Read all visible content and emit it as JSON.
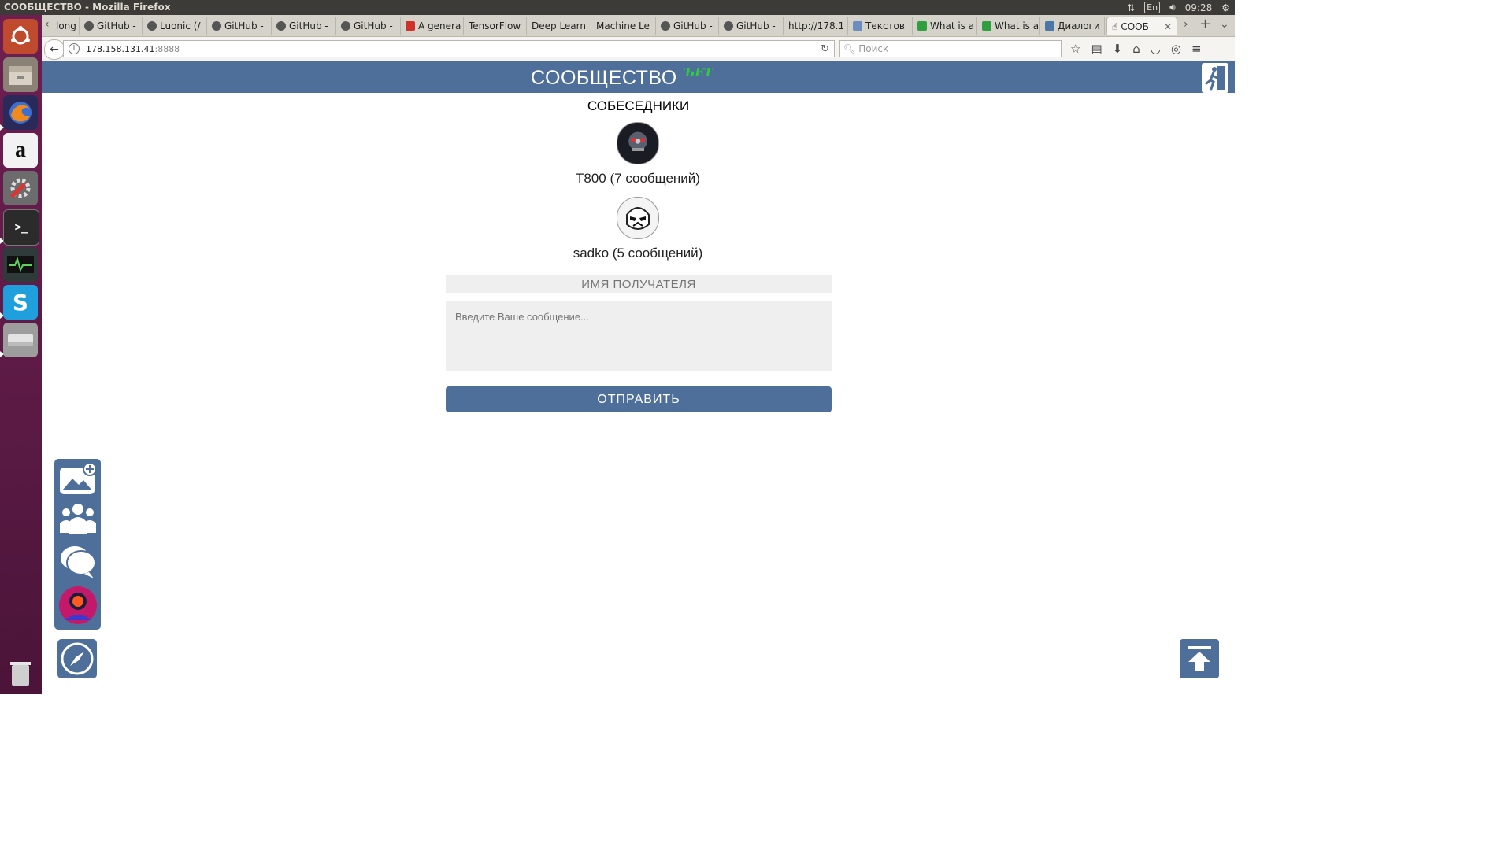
{
  "os_panel": {
    "window_title": "СООБЩЕСТВО - Mozilla Firefox",
    "keyboard_layout": "En",
    "time": "09:28"
  },
  "launcher": {
    "items": [
      "ubuntu-dash",
      "files",
      "firefox",
      "amazon",
      "system-settings",
      "terminal",
      "system-monitor",
      "skype",
      "disks",
      "trash"
    ]
  },
  "tabs": [
    {
      "label": "long",
      "icon": "github-icon"
    },
    {
      "label": "GitHub -",
      "icon": "github-icon"
    },
    {
      "label": "Luonic (/",
      "icon": "github-icon"
    },
    {
      "label": "GitHub -",
      "icon": "github-icon"
    },
    {
      "label": "GitHub -",
      "icon": "github-icon"
    },
    {
      "label": "GitHub -",
      "icon": "github-icon"
    },
    {
      "label": "A genera",
      "icon": "s-icon"
    },
    {
      "label": "TensorFlow",
      "icon": ""
    },
    {
      "label": "Deep Learn",
      "icon": ""
    },
    {
      "label": "Machine Le",
      "icon": ""
    },
    {
      "label": "GitHub -",
      "icon": "github-icon"
    },
    {
      "label": "GitHub -",
      "icon": "github-icon"
    },
    {
      "label": "http://178.1",
      "icon": ""
    },
    {
      "label": "Текстов",
      "icon": "h-icon"
    },
    {
      "label": "What is a",
      "icon": "green-icon"
    },
    {
      "label": "What is a",
      "icon": "green-icon"
    },
    {
      "label": "Диалоги",
      "icon": "vk-icon"
    },
    {
      "label": "СООБ",
      "icon": "hand-icon",
      "active": true
    }
  ],
  "navbar": {
    "url_host": "178.158.131.41",
    "url_port": ":8888",
    "search_placeholder": "Поиск"
  },
  "page": {
    "site_title": "СООБЩЕСТВО",
    "beta_label": "ЪЕТ",
    "section_title": "СОБЕСЕДНИКИ",
    "contacts": [
      {
        "label": "T800 (7 сообщений)",
        "avatar": "t800-avatar"
      },
      {
        "label": "sadko (5 сообщений)",
        "avatar": "stormtrooper-avatar"
      }
    ],
    "recipient_placeholder": "ИМЯ ПОЛУЧАТЕЛЯ",
    "message_placeholder": "Введите Ваше сообщение...",
    "send_label": "ОТПРАВИТЬ"
  },
  "colors": {
    "brand": "#4f6f9b",
    "beta_green": "#2ecc40",
    "input_bg": "#efefef"
  }
}
